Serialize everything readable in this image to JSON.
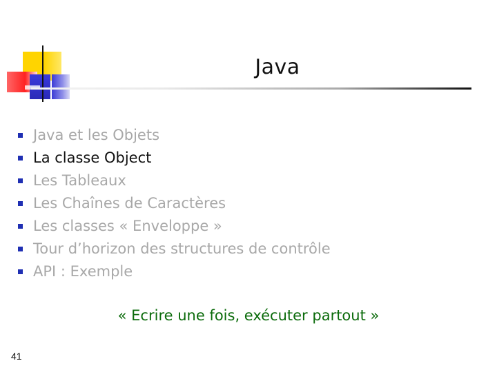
{
  "slide": {
    "title": "Java",
    "items": [
      {
        "label": "Java et les Objets",
        "active": false
      },
      {
        "label": "La classe Object",
        "active": true
      },
      {
        "label": "Les Tableaux",
        "active": false
      },
      {
        "label": "Les Chaînes de Caractères",
        "active": false
      },
      {
        "label": "Les classes « Enveloppe »",
        "active": false
      },
      {
        "label": "Tour d’horizon des structures de contrôle",
        "active": false
      },
      {
        "label": "API : Exemple",
        "active": false
      }
    ],
    "slogan": "« Ecrire une fois, exécuter partout »",
    "page_number": "41"
  },
  "colors": {
    "bullet": "#1f2fb3",
    "active_text": "#111111",
    "inactive_text": "#a8a8a8",
    "slogan": "#0b6b0b"
  }
}
